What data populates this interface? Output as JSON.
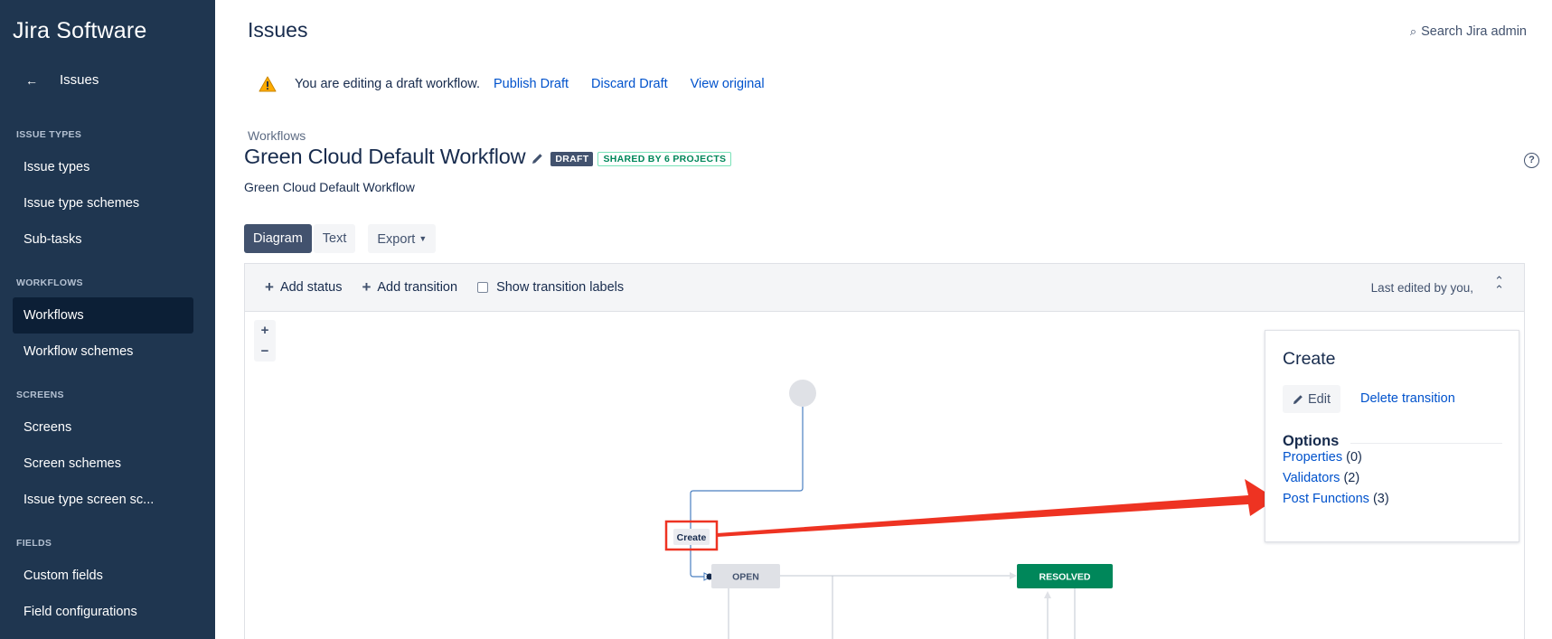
{
  "app": {
    "brand": "Jira Software"
  },
  "sidebar": {
    "back_label": "Issues",
    "sections": [
      {
        "heading": "ISSUE TYPES",
        "items": [
          "Issue types",
          "Issue type schemes",
          "Sub-tasks"
        ]
      },
      {
        "heading": "WORKFLOWS",
        "items": [
          "Workflows",
          "Workflow schemes"
        ]
      },
      {
        "heading": "SCREENS",
        "items": [
          "Screens",
          "Screen schemes",
          "Issue type screen sc..."
        ]
      },
      {
        "heading": "FIELDS",
        "items": [
          "Custom fields",
          "Field configurations"
        ]
      }
    ],
    "active_item": "Workflows"
  },
  "header": {
    "title": "Issues",
    "search_admin": "Search Jira admin"
  },
  "draft_notice": {
    "message": "You are editing a draft workflow.",
    "publish": "Publish Draft",
    "discard": "Discard Draft",
    "view_original": "View original"
  },
  "workflow": {
    "breadcrumb": "Workflows",
    "name": "Green Cloud Default Workflow",
    "draft_lozenge": "DRAFT",
    "shared_lozenge": "SHARED BY 6 PROJECTS",
    "description": "Green Cloud Default Workflow"
  },
  "tabs": {
    "diagram": "Diagram",
    "text": "Text",
    "export": "Export"
  },
  "toolbar": {
    "add_status": "Add status",
    "add_transition": "Add transition",
    "show_labels": "Show transition labels",
    "last_edited": "Last edited by you,"
  },
  "zoom": {
    "in": "+",
    "out": "−"
  },
  "diagram": {
    "transition_label": "Create",
    "statuses": [
      {
        "name": "OPEN",
        "color": "#dfe1e6",
        "text_color": "#42526e"
      },
      {
        "name": "RESOLVED",
        "color": "#00875a",
        "text_color": "#ffffff"
      }
    ],
    "annotation_color": "#ee3322"
  },
  "panel": {
    "title": "Create",
    "edit": "Edit",
    "delete": "Delete transition",
    "options_heading": "Options",
    "options": [
      {
        "label": "Properties",
        "count": "(0)"
      },
      {
        "label": "Validators",
        "count": "(2)"
      },
      {
        "label": "Post Functions",
        "count": "(3)"
      }
    ]
  }
}
